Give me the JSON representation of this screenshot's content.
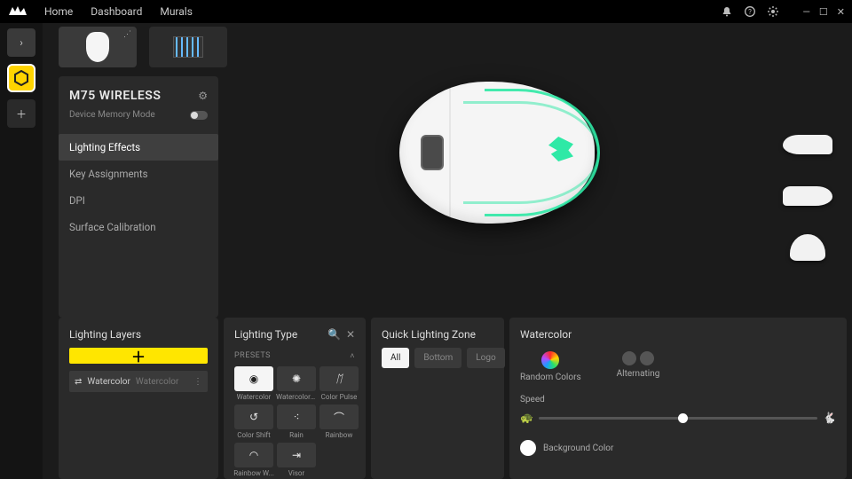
{
  "titlebar": {
    "nav": [
      "Home",
      "Dashboard",
      "Murals"
    ]
  },
  "device": {
    "name": "M75 WIRELESS",
    "memory_mode_label": "Device Memory Mode",
    "menu": {
      "lighting": "Lighting Effects",
      "keys": "Key Assignments",
      "dpi": "DPI",
      "surface": "Surface Calibration"
    }
  },
  "layers": {
    "title": "Lighting Layers",
    "row": {
      "name": "Watercolor",
      "type_ghost": "Watercolor"
    }
  },
  "lighting_type": {
    "title": "Lighting Type",
    "presets_label": "PRESETS",
    "presets": [
      "Watercolor",
      "Watercolor ...",
      "Color Pulse",
      "Color Shift",
      "Rain",
      "Rainbow",
      "Rainbow W...",
      "Visor"
    ]
  },
  "quick_zone": {
    "title": "Quick Lighting Zone",
    "pills": [
      "All",
      "Bottom",
      "Logo"
    ]
  },
  "effect": {
    "title": "Watercolor",
    "random_label": "Random Colors",
    "alternating_label": "Alternating",
    "speed_label": "Speed",
    "bg_label": "Background Color"
  }
}
